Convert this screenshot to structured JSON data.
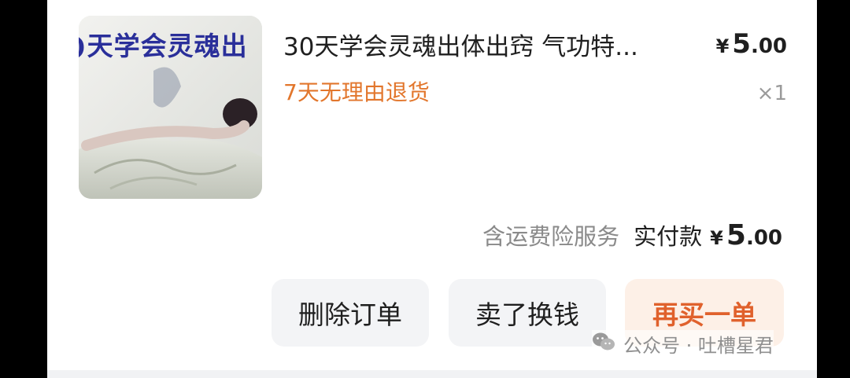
{
  "product": {
    "thumbnail_caption": ")天学会灵魂出",
    "title": "30天学会灵魂出体出窍 气功特...",
    "price": {
      "currency": "¥",
      "integer": "5",
      "decimal": ".00"
    },
    "return_policy": "7天无理由退货",
    "quantity": "×1"
  },
  "summary": {
    "insurance_note": "含运费险服务",
    "paid_label": "实付款",
    "paid": {
      "currency": "¥",
      "integer": "5",
      "decimal": ".00"
    }
  },
  "actions": {
    "delete": "删除订单",
    "sell": "卖了换钱",
    "rebuy": "再买一单"
  },
  "watermark": {
    "icon": "wechat-icon",
    "text": "公众号 · 吐槽星君"
  },
  "colors": {
    "accent": "#e2762c",
    "rebuy_bg": "#fdf0e7",
    "rebuy_text": "#e0612c",
    "button_bg": "#f3f4f6"
  }
}
